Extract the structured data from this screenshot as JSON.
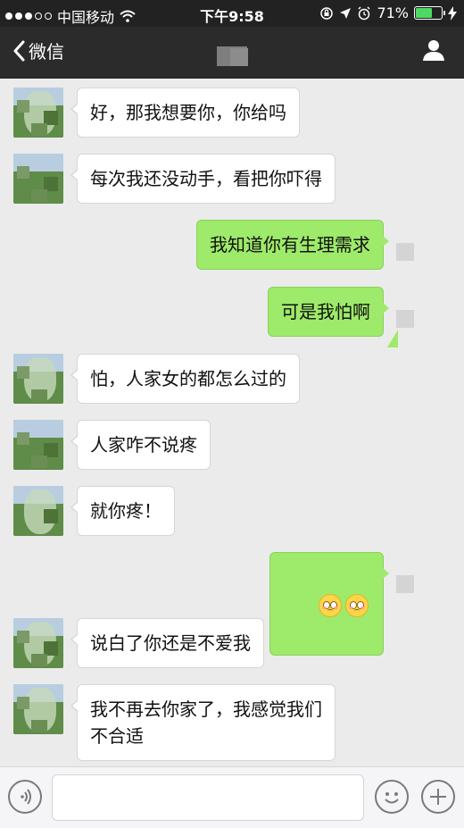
{
  "status_bar": {
    "carrier": "中国移动",
    "time": "下午9:58",
    "battery_percent": "71%",
    "battery_level": 0.71,
    "signal_icon": "signal-dots-icon",
    "wifi_icon": "wifi-icon"
  },
  "nav": {
    "back_label": "微信",
    "back_icon": "chevron-left-icon",
    "profile_icon": "person-icon"
  },
  "messages": [
    {
      "side": "left",
      "text": "好，那我想要你，你给吗"
    },
    {
      "side": "left",
      "text": "每次我还没动手，看把你吓得"
    },
    {
      "side": "right",
      "text": "我知道你有生理需求"
    },
    {
      "side": "right",
      "text": "可是我怕啊"
    },
    {
      "side": "left",
      "text": "怕，人家女的都怎么过的"
    },
    {
      "side": "left",
      "text": "人家咋不说疼"
    },
    {
      "side": "left",
      "text": "就你疼！"
    },
    {
      "side": "right",
      "text": "",
      "emoji_count": 2,
      "emoji_icon": "flushed-face-emoji"
    },
    {
      "side": "left",
      "text": "说白了你还是不爱我"
    },
    {
      "side": "left",
      "text": "我不再去你家了，我感觉我们\n不合适"
    }
  ],
  "input_bar": {
    "voice_icon": "voice-icon",
    "emoji_icon": "emoji-face-icon",
    "plus_icon": "plus-icon",
    "input_value": ""
  },
  "colors": {
    "chat_bg": "#ebebeb",
    "sent_bubble": "#9eea6a",
    "received_bubble": "#ffffff",
    "nav_bg": "#2b2b2b",
    "battery_fill": "#4cd964"
  }
}
